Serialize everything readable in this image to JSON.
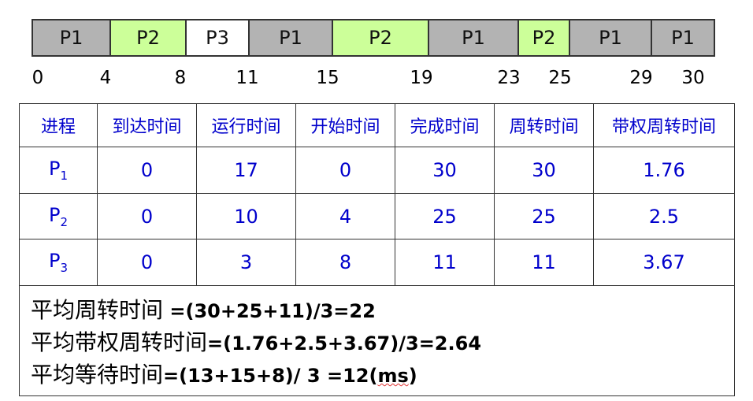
{
  "gantt": {
    "colors": {
      "P1": "#b3b3b3",
      "P2": "#ccff99",
      "P3": "#ffffff"
    },
    "segments": [
      {
        "label": "P1",
        "start": 0,
        "end": 4
      },
      {
        "label": "P2",
        "start": 4,
        "end": 8
      },
      {
        "label": "P3",
        "start": 8,
        "end": 11
      },
      {
        "label": "P1",
        "start": 11,
        "end": 15
      },
      {
        "label": "P2",
        "start": 15,
        "end": 19
      },
      {
        "label": "P1",
        "start": 19,
        "end": 23
      },
      {
        "label": "P2",
        "start": 23,
        "end": 25
      },
      {
        "label": "P1",
        "start": 25,
        "end": 29
      },
      {
        "label": "P1",
        "start": 29,
        "end": 30
      }
    ],
    "ticks": [
      "0",
      "4",
      "8",
      "11",
      "15",
      "19",
      "23",
      "25",
      "29",
      "30"
    ]
  },
  "table": {
    "headers": [
      "进程",
      "到达时间",
      "运行时间",
      "开始时间",
      "完成时间",
      "周转时间",
      "带权周转时间"
    ],
    "rows": [
      {
        "proc": "P",
        "sub": "1",
        "arrive": "0",
        "run": "17",
        "start": "0",
        "finish": "30",
        "turnaround": "30",
        "weighted": "1.76"
      },
      {
        "proc": "P",
        "sub": "2",
        "arrive": "0",
        "run": "10",
        "start": "4",
        "finish": "25",
        "turnaround": "25",
        "weighted": "2.5"
      },
      {
        "proc": "P",
        "sub": "3",
        "arrive": "0",
        "run": "3",
        "start": "8",
        "finish": "11",
        "turnaround": "11",
        "weighted": "3.67"
      }
    ]
  },
  "summary": {
    "avg_turnaround_label": "平均周转时间",
    "avg_turnaround_formula": " =(30+25+11)/3=22",
    "avg_weighted_label": "平均带权周转时间",
    "avg_weighted_formula": "=(1.76+2.5+3.67)/3=2.64",
    "avg_wait_label": "平均等待时间",
    "avg_wait_formula_pre": "=(13+15+8)/ 3 =12(",
    "avg_wait_unit": "ms",
    "avg_wait_formula_post": ")"
  }
}
